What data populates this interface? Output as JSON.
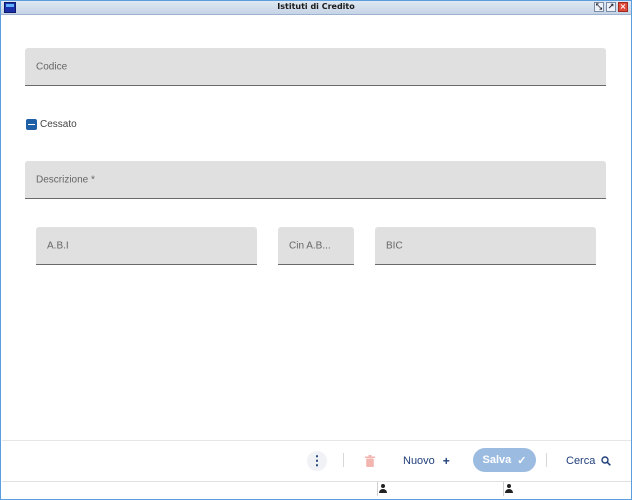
{
  "window": {
    "title": "Istituti di Credito",
    "buttons": [
      "minimize",
      "maximize",
      "close"
    ]
  },
  "form": {
    "codice": {
      "label": "Codice",
      "value": ""
    },
    "cessato": {
      "label": "Cessato",
      "state": "indeterminate"
    },
    "descrizione": {
      "label": "Descrizione *",
      "value": ""
    },
    "abi": {
      "label": "A.B.I",
      "value": ""
    },
    "cin_abi": {
      "label": "Cin A.B...",
      "value": ""
    },
    "bic": {
      "label": "BIC",
      "value": ""
    }
  },
  "toolbar": {
    "more_icon": "vertical-dots-icon",
    "delete_icon": "trash-icon",
    "nuovo_label": "Nuovo",
    "nuovo_icon": "+",
    "salva_label": "Salva",
    "salva_icon": "✓",
    "cerca_label": "Cerca",
    "cerca_icon": "search-icon"
  },
  "colors": {
    "accent": "#1f5fa6",
    "salva_bg": "#9bbbe0",
    "field_bg": "#e0e0e0",
    "delete_disabled": "#f3b5b0"
  },
  "statusbar": {
    "cells": [
      {
        "icon": "user-icon"
      },
      {
        "icon": "user-icon"
      }
    ]
  }
}
